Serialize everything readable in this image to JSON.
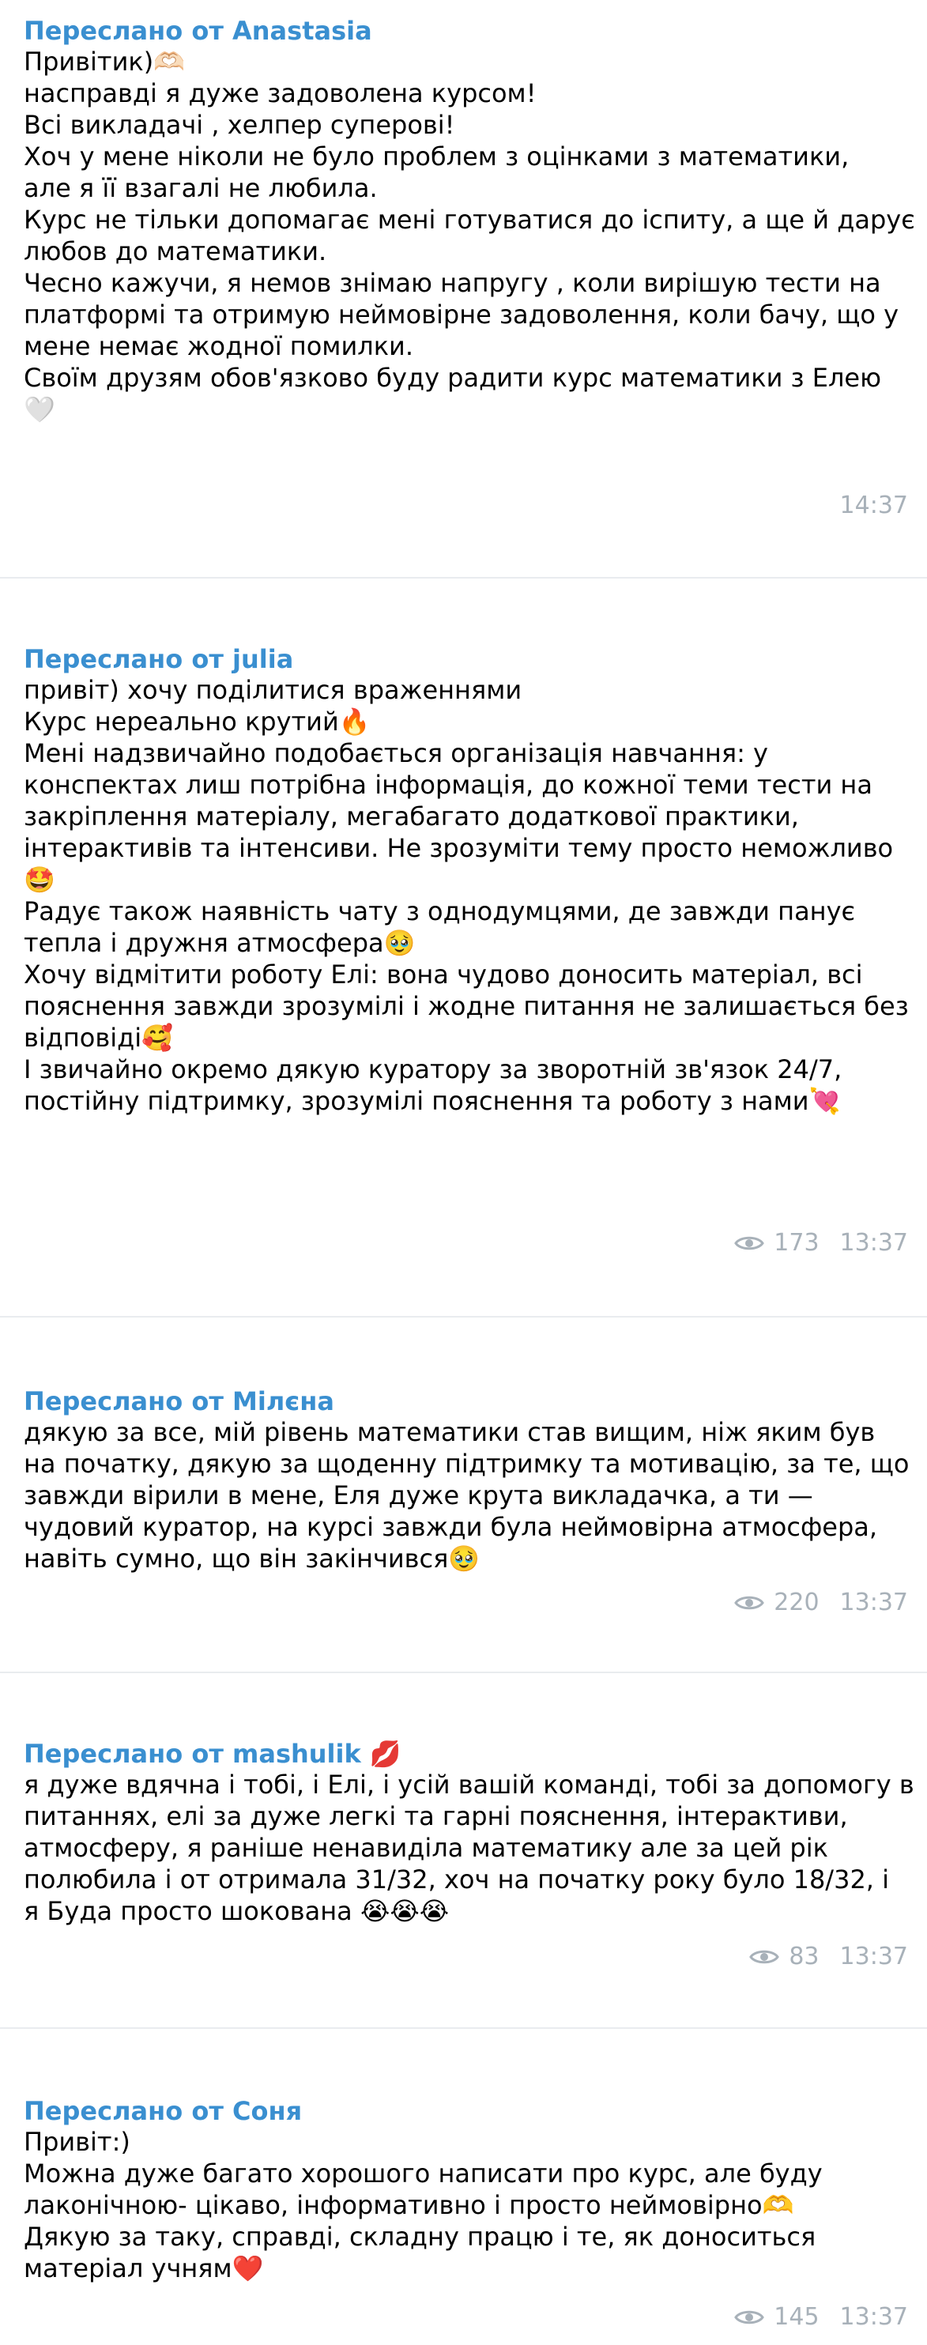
{
  "messages": [
    {
      "sender": "Переслано от Anastasia",
      "lines": [
        "Привітик)🫶🏻",
        "насправді я дуже задоволена курсом!",
        "Всі викладачі , хелпер суперові!",
        "Хоч у мене ніколи не було проблем з оцінками з математики,",
        "але я її взагалі не любила.",
        "Курс не тільки допомагає мені готуватися до іспиту, а ще й дарує",
        "любов до математики.",
        "Чесно кажучи, я немов знімаю напругу , коли вирішую тести на",
        "платформі та отримую неймовірне задоволення, коли бачу, що у",
        "мене немає жодної помилки.",
        "Своїм друзям обов'язково буду радити курс математики з Елею",
        "🤍"
      ],
      "views": "",
      "time": "14:37"
    },
    {
      "sender": "Переслано от julia",
      "lines": [
        "привіт) хочу поділитися враженнями",
        "Курс нереально крутий🔥",
        "Мені надзвичайно подобається організація навчання: у",
        "конспектах лиш потрібна інформація, до кожної теми тести на",
        "закріплення матеріалу, мегабагато додаткової практики,",
        "інтерактивів та інтенсиви. Не зрозуміти тему просто неможливо",
        "🤩",
        "Радує також наявність чату з однодумцями, де завжди панує",
        "тепла і дружня атмосфера🥹",
        "Хочу відмітити роботу Елі: вона чудово доносить матеріал, всі",
        "пояснення завжди зрозумілі і жодне питання не залишається без",
        "відповіді🥰",
        "І звичайно окремо дякую куратору за зворотній зв'язок 24/7,",
        "постійну підтримку, зрозумілі пояснення та роботу з нами💘"
      ],
      "views": "173",
      "time": "13:37"
    },
    {
      "sender": "Переслано от Мілєна",
      "lines": [
        "дякую за все, мій рівень математики став вищим, ніж яким був",
        "на початку, дякую за щоденну підтримку та мотивацію, за те, що",
        "завжди вірили в мене, Еля дуже крута викладачка, а ти —",
        "чудовий куратор, на курсі завжди була неймовірна атмосфера,",
        "навіть сумно, що він закінчився🥹"
      ],
      "views": "220",
      "time": "13:37"
    },
    {
      "sender": "Переслано от mashulik 💋",
      "lines": [
        "я дуже вдячна і тобі, і Елі, і усій вашій команді, тобі за допомогу в",
        "питаннях, елі за дуже легкі та гарні пояснення, інтерактиви,",
        "атмосферу, я раніше ненавиділа математику але за цей рік",
        "полюбила і от отримала 31/32, хоч на початку року було 18/32, і",
        "я Буда просто шокована 😭😭😭"
      ],
      "views": "83",
      "time": "13:37"
    },
    {
      "sender": "Переслано от Соня",
      "lines": [
        "Привіт:)",
        "Можна дуже багато хорошого написати про курс, але буду",
        "лаконічною- цікаво, інформативно і просто неймовірно🫶",
        "Дякую за таку, справді, складну працю і те, як доноситься",
        "матеріал учням❤️"
      ],
      "views": "145",
      "time": "13:37"
    }
  ],
  "icons": {
    "views": "eye-icon"
  },
  "colors": {
    "sender": "#3a8fd0",
    "meta": "#a8b1b9",
    "divider": "#e9ecef"
  }
}
